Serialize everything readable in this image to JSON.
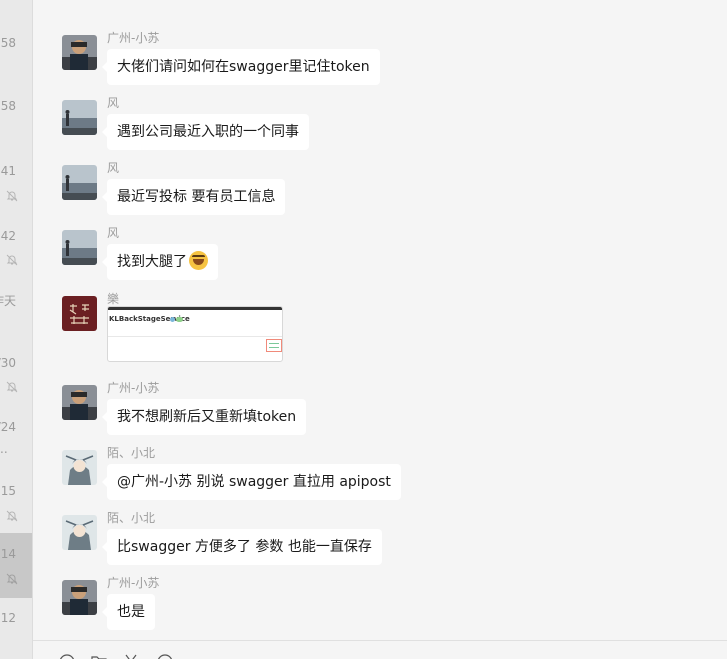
{
  "sidebar": {
    "items": [
      {
        "time": ":58",
        "muted": false,
        "active": false
      },
      {
        "time": ":58",
        "muted": false,
        "active": false
      },
      {
        "time": ":41",
        "muted": true,
        "active": false
      },
      {
        "time": ":42",
        "muted": true,
        "active": false
      },
      {
        "time": "昨天",
        "muted": false,
        "active": false
      },
      {
        "time": "/30",
        "muted": true,
        "active": false
      },
      {
        "time": "/24",
        "muted": false,
        "active": false,
        "extra": ".."
      },
      {
        "time": ":15",
        "muted": true,
        "active": false
      },
      {
        "time": ":14",
        "muted": true,
        "active": true
      },
      {
        "time": ":12",
        "muted": false,
        "active": false
      }
    ]
  },
  "chat": {
    "messages": [
      {
        "sender": "广州-小苏",
        "text": "大佬们请问如何在swagger里记住token",
        "avatar": "photo-avatar"
      },
      {
        "sender": "风",
        "text": "遇到公司最近入职的一个同事",
        "avatar": "landscape-avatar"
      },
      {
        "sender": "风",
        "text": "最近写投标 要有员工信息",
        "avatar": "landscape-avatar"
      },
      {
        "sender": "风",
        "text": "找到大腿了",
        "avatar": "landscape-avatar",
        "emoji": "laugh-emoji"
      },
      {
        "sender": "樂",
        "image": {
          "title": "KLBackStageService"
        },
        "avatar": "calligraphy-avatar"
      },
      {
        "sender": "广州-小苏",
        "text": "我不想刷新后又重新填token",
        "avatar": "photo-avatar"
      },
      {
        "sender": "陌、小北",
        "text": "@广州-小苏  别说 swagger 直拉用 apipost",
        "avatar": "anime-avatar"
      },
      {
        "sender": "陌、小北",
        "text": "比swagger 方便多了 参数 也能一直保存",
        "avatar": "anime-avatar"
      },
      {
        "sender": "广州-小苏",
        "text": "也是",
        "avatar": "photo-avatar"
      }
    ]
  },
  "toolbar": {
    "icons": [
      "emoji-icon",
      "folder-icon",
      "scissors-icon",
      "chat-history-icon"
    ]
  },
  "colors": {
    "chat_bg": "#f5f5f5",
    "bubble_bg": "#ffffff",
    "sender_text": "#9c9c9c",
    "sidebar_bg": "#e9e9e9",
    "sidebar_active": "#c8c8c8"
  }
}
